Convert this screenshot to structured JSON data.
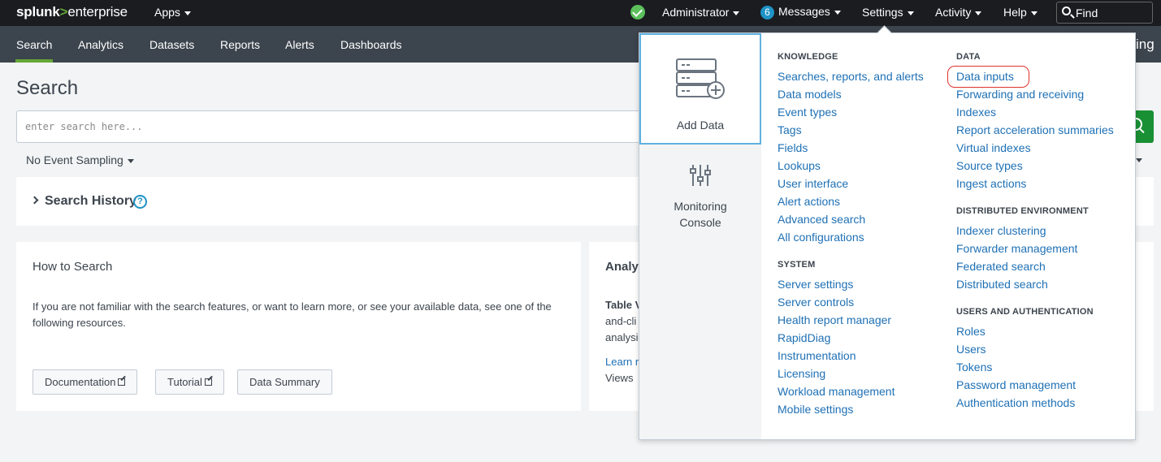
{
  "topbar": {
    "logo": {
      "splunk": "splunk",
      "gt": ">",
      "enterprise": "enterprise"
    },
    "apps_label": "Apps",
    "user_label": "Administrator",
    "messages_count": "6",
    "messages_label": "Messages",
    "settings_label": "Settings",
    "activity_label": "Activity",
    "help_label": "Help",
    "find_label": "Find",
    "status_color": "#5cc05c"
  },
  "appbar": {
    "tabs": [
      {
        "label": "Search",
        "active": true
      },
      {
        "label": "Analytics"
      },
      {
        "label": "Datasets"
      },
      {
        "label": "Reports"
      },
      {
        "label": "Alerts"
      },
      {
        "label": "Dashboards"
      }
    ],
    "right_label": "ing",
    "active_color": "#65a637"
  },
  "page": {
    "title": "Search",
    "search_placeholder": "enter search here...",
    "sampling_label": "No Event Sampling",
    "history_title": "Search History",
    "help_glyph": "?"
  },
  "howto": {
    "title": "How to Search",
    "text": "If you are not familiar with the search features, or want to learn more, or see your available data, see one of the following resources.",
    "buttons": [
      "Documentation",
      "Tutorial",
      "Data Summary"
    ]
  },
  "analytics": {
    "title": "Analy",
    "line1": "Table V",
    "line2": "and-cli",
    "line3": "analysi",
    "line4": "Learn r",
    "line5": "Views"
  },
  "settings_menu": {
    "tiles": [
      {
        "label": "Add Data",
        "icon": "add-data-icon"
      },
      {
        "label_line1": "Monitoring",
        "label_line2": "Console",
        "icon": "sliders-icon"
      }
    ],
    "knowledge": {
      "title": "KNOWLEDGE",
      "items": [
        "Searches, reports, and alerts",
        "Data models",
        "Event types",
        "Tags",
        "Fields",
        "Lookups",
        "User interface",
        "Alert actions",
        "Advanced search",
        "All configurations"
      ]
    },
    "system": {
      "title": "SYSTEM",
      "items": [
        "Server settings",
        "Server controls",
        "Health report manager",
        "RapidDiag",
        "Instrumentation",
        "Licensing",
        "Workload management",
        "Mobile settings"
      ]
    },
    "data": {
      "title": "DATA",
      "items": [
        "Data inputs",
        "Forwarding and receiving",
        "Indexes",
        "Report acceleration summaries",
        "Virtual indexes",
        "Source types",
        "Ingest actions"
      ]
    },
    "distributed": {
      "title": "DISTRIBUTED ENVIRONMENT",
      "items": [
        "Indexer clustering",
        "Forwarder management",
        "Federated search",
        "Distributed search"
      ]
    },
    "users": {
      "title": "USERS AND AUTHENTICATION",
      "items": [
        "Roles",
        "Users",
        "Tokens",
        "Password management",
        "Authentication methods"
      ]
    },
    "link_color": "#1e70b5",
    "highlight_color": "#e0332b"
  }
}
